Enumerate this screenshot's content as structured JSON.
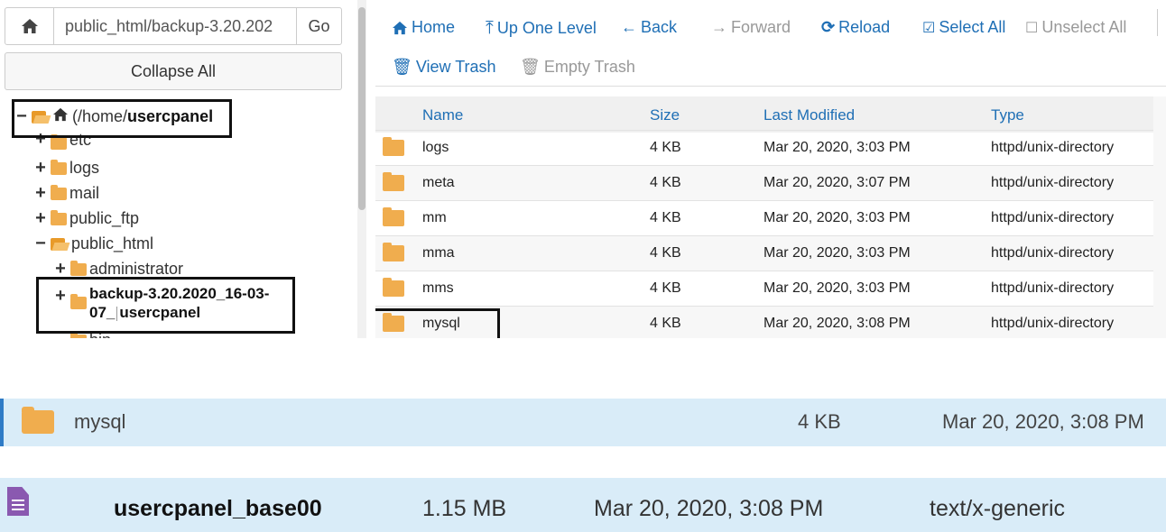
{
  "left_panel": {
    "path_value": "public_html/backup-3.20.202",
    "go_label": "Go",
    "collapse_label": "Collapse All",
    "tree": {
      "root_label_prefix": "(/home/ ",
      "root_label_user": "usercpan",
      "root_label_suffix": "el",
      "items": [
        {
          "toggle": "+",
          "label": "etc"
        },
        {
          "toggle": "+",
          "label": "logs"
        },
        {
          "toggle": "+",
          "label": "mail"
        },
        {
          "toggle": "+",
          "label": "public_ftp"
        },
        {
          "toggle": "−",
          "label": "public_html"
        },
        {
          "toggle": "+",
          "label": "administrator"
        },
        {
          "toggle": "+",
          "label_line1": "backup-3.20.2020_16-03-",
          "label_line2_a": "07_",
          "label_line2_b": "usercpanel"
        },
        {
          "label": "bin"
        }
      ]
    }
  },
  "toolbar": {
    "home": "Home",
    "up_one_level": "Up One Level",
    "back": "Back",
    "forward": "Forward",
    "reload": "Reload",
    "select_all": "Select All",
    "unselect_all": "Unselect All",
    "view_trash": "View Trash",
    "empty_trash": "Empty Trash"
  },
  "file_table": {
    "headers": {
      "name": "Name",
      "size": "Size",
      "last_modified": "Last Modified",
      "type": "Type"
    },
    "rows": [
      {
        "name": "logs",
        "size": "4 KB",
        "modified": "Mar 20, 2020, 3:03 PM",
        "type": "httpd/unix-directory"
      },
      {
        "name": "meta",
        "size": "4 KB",
        "modified": "Mar 20, 2020, 3:07 PM",
        "type": "httpd/unix-directory"
      },
      {
        "name": "mm",
        "size": "4 KB",
        "modified": "Mar 20, 2020, 3:03 PM",
        "type": "httpd/unix-directory"
      },
      {
        "name": "mma",
        "size": "4 KB",
        "modified": "Mar 20, 2020, 3:03 PM",
        "type": "httpd/unix-directory"
      },
      {
        "name": "mms",
        "size": "4 KB",
        "modified": "Mar 20, 2020, 3:03 PM",
        "type": "httpd/unix-directory"
      },
      {
        "name": "mysql",
        "size": "4 KB",
        "modified": "Mar 20, 2020, 3:08 PM",
        "type": "httpd/unix-directory"
      }
    ]
  },
  "zoom_folder_row": {
    "name": "mysql",
    "size": "4 KB",
    "modified": "Mar 20, 2020, 3:08 PM"
  },
  "zoom_file_row": {
    "name": "usercpanel_base00",
    "size": "1.15 MB",
    "modified": "Mar 20, 2020, 3:08 PM",
    "type": "text/x-generic"
  },
  "colors": {
    "link_blue": "#1f6fb5",
    "row_highlight": "#d9ecf8",
    "folder": "#f0ad4e",
    "file_icon": "#8a59b0"
  }
}
